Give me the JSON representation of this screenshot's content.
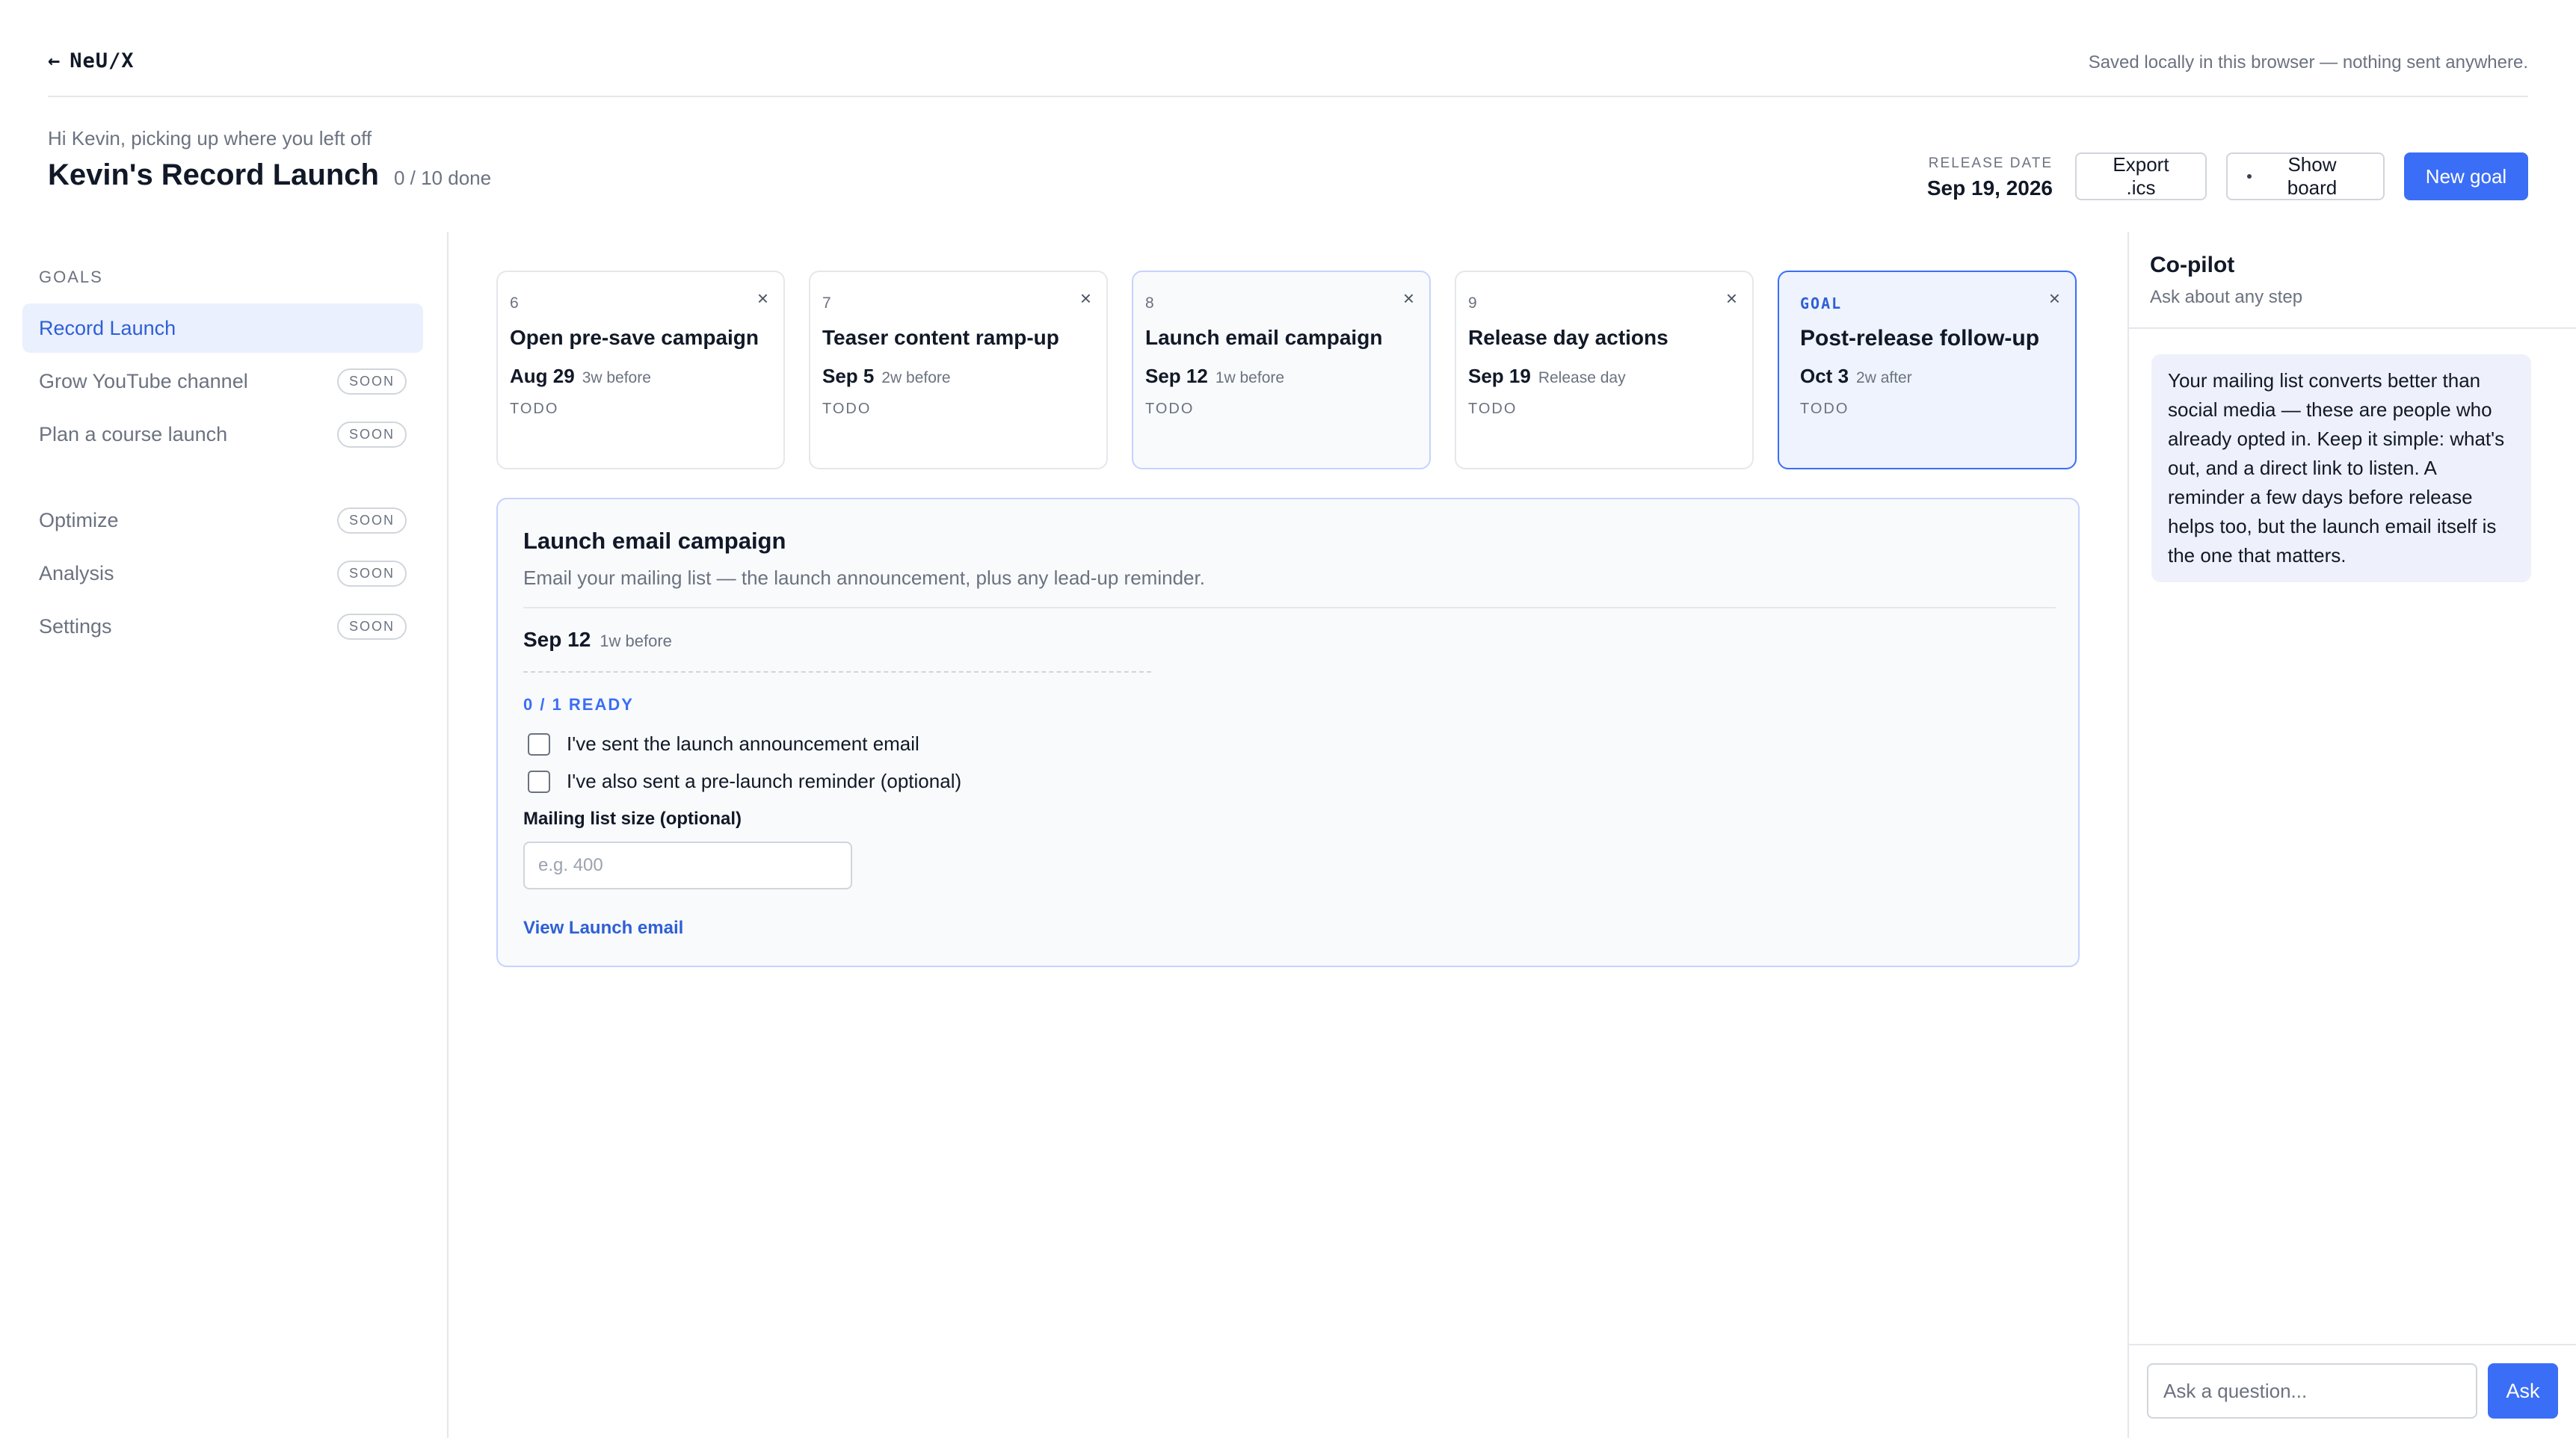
{
  "topbar": {
    "back_arrow": "←",
    "brand": "NeU/X",
    "note": "Saved locally in this browser — nothing sent anywhere."
  },
  "header": {
    "greeting": "Hi Kevin, picking up where you left off",
    "title": "Kevin's Record Launch",
    "progress": "0 / 10 done",
    "release_label": "RELEASE DATE",
    "release_date": "Sep 19, 2026",
    "export_label": "Export .ics",
    "show_board_label": "Show board",
    "new_goal_label": "New goal"
  },
  "sidebar": {
    "heading": "GOALS",
    "goals": [
      {
        "label": "Record Launch",
        "active": true
      },
      {
        "label": "Grow YouTube channel",
        "badge": "SOON"
      },
      {
        "label": "Plan a course launch",
        "badge": "SOON"
      }
    ],
    "tools": [
      {
        "label": "Optimize",
        "badge": "SOON"
      },
      {
        "label": "Analysis",
        "badge": "SOON"
      },
      {
        "label": "Settings",
        "badge": "SOON"
      }
    ]
  },
  "steps": [
    {
      "num": "6",
      "title": "Open pre-save campaign",
      "date": "Aug 29",
      "relative": "3w before",
      "status": "TODO",
      "close": "×"
    },
    {
      "num": "7",
      "title": "Teaser content ramp-up",
      "date": "Sep 5",
      "relative": "2w before",
      "status": "TODO",
      "close": "×"
    },
    {
      "num": "8",
      "title": "Launch email campaign",
      "date": "Sep 12",
      "relative": "1w before",
      "status": "TODO",
      "close": "×"
    },
    {
      "num": "9",
      "title": "Release day actions",
      "date": "Sep 19",
      "relative": "Release day",
      "status": "TODO",
      "close": "×"
    },
    {
      "tag": "GOAL",
      "title": "Post-release follow-up",
      "date": "Oct 3",
      "relative": "2w after",
      "status": "TODO",
      "close": "×"
    }
  ],
  "detail": {
    "title": "Launch email campaign",
    "description": "Email your mailing list — the launch announcement, plus any lead-up reminder.",
    "date": "Sep 12",
    "relative": "1w before",
    "ready": "0 / 1 READY",
    "checklist": [
      {
        "label": "I've sent the launch announcement email",
        "checked": false
      },
      {
        "label": "I've also sent a pre-launch reminder (optional)",
        "checked": false
      }
    ],
    "field_label": "Mailing list size (optional)",
    "field_placeholder": "e.g. 400",
    "field_value": "",
    "link": "View Launch email"
  },
  "copilot": {
    "title": "Co-pilot",
    "subtitle": "Ask about any step",
    "message": "Your mailing list converts better than social media — these are people who already opted in. Keep it simple: what's out, and a direct link to listen. A reminder a few days before release helps too, but the launch email itself is the one that matters.",
    "input_placeholder": "Ask a question...",
    "ask_label": "Ask"
  },
  "colors": {
    "accent": "#3b6ef6",
    "accent_text": "#2f5fd6",
    "active_bg": "#eaf0fe",
    "muted": "#6b7280"
  }
}
